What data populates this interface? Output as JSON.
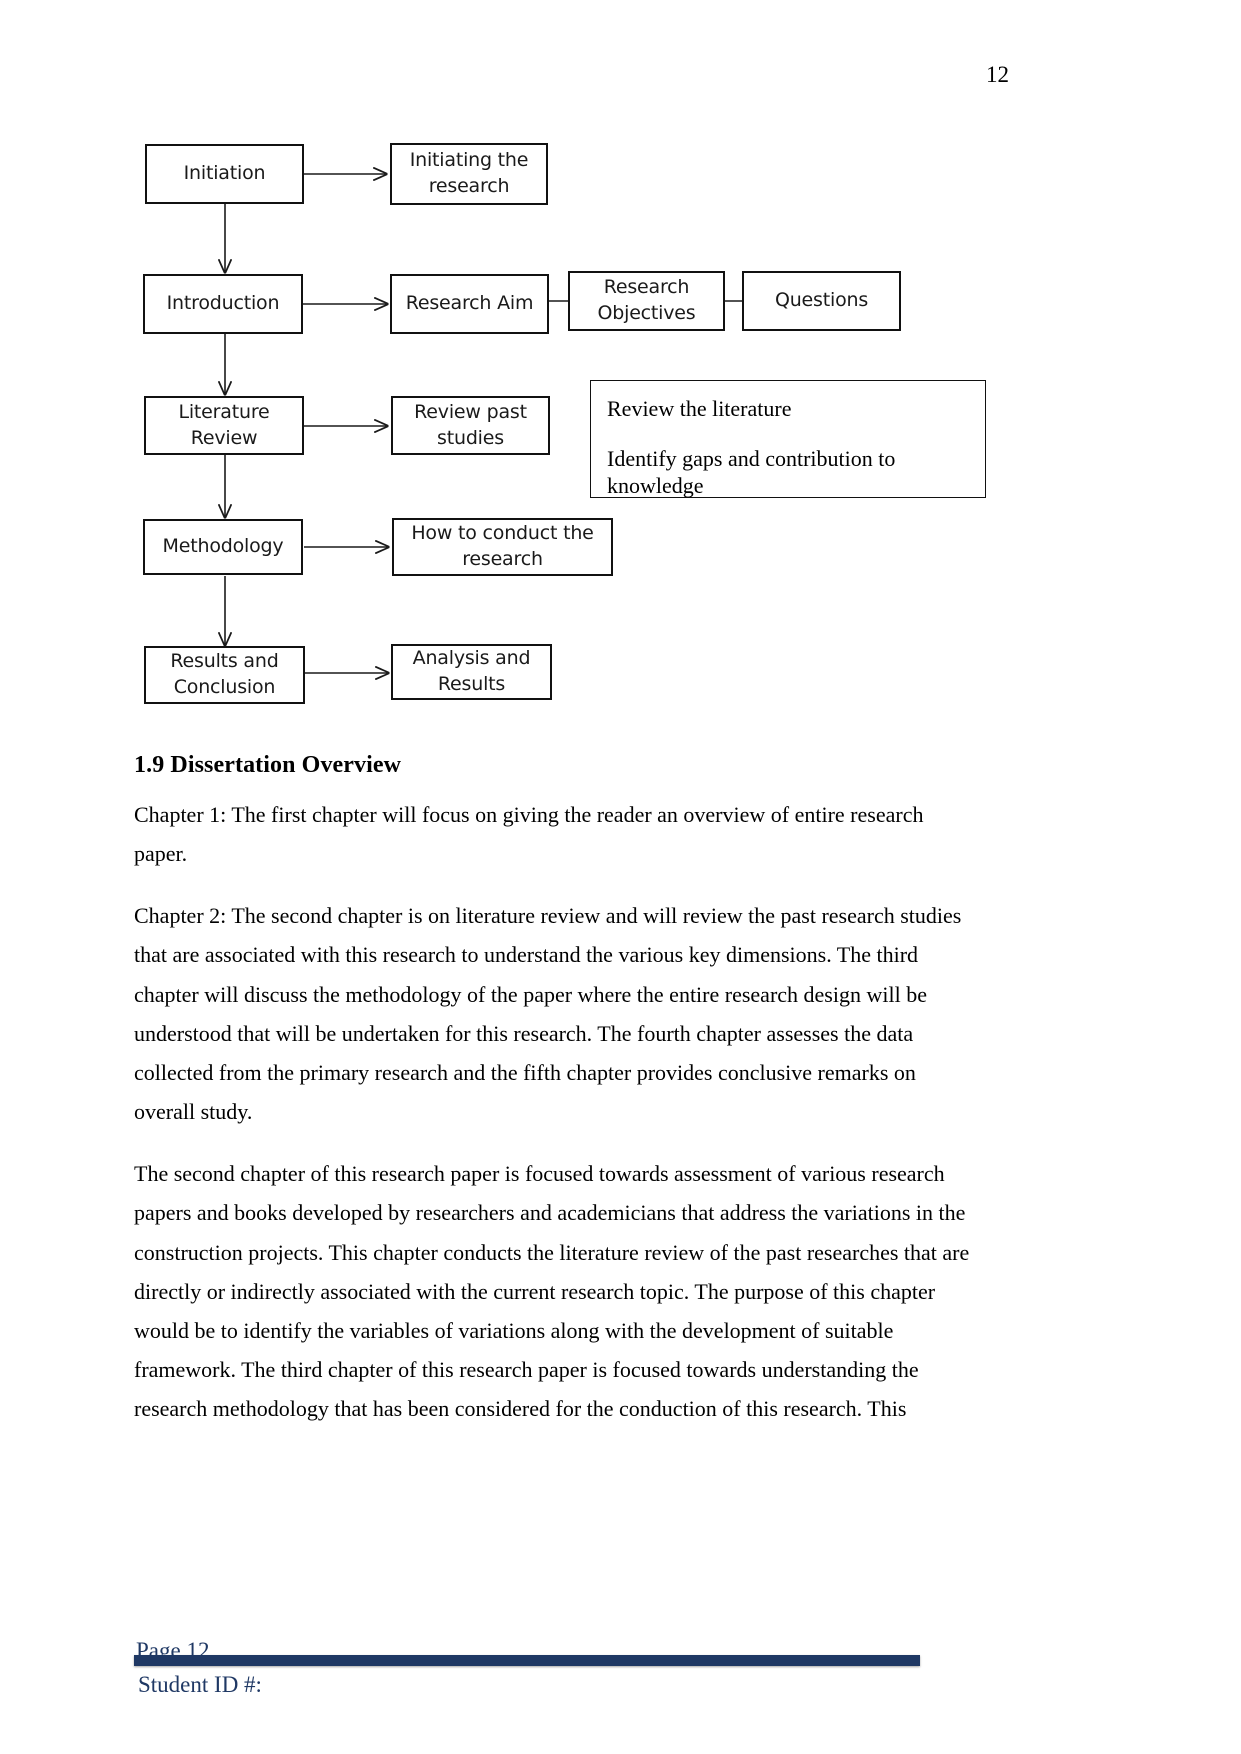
{
  "page": {
    "number": "12"
  },
  "flowchart": {
    "nodes": [
      {
        "id": "initiation",
        "label": "Initiation"
      },
      {
        "id": "initiating-research",
        "label": "Initiating the research"
      },
      {
        "id": "introduction",
        "label": "Introduction"
      },
      {
        "id": "research-aim",
        "label": "Research Aim"
      },
      {
        "id": "research-objectives",
        "label": "Research Objectives"
      },
      {
        "id": "questions",
        "label": "Questions"
      },
      {
        "id": "literature-review",
        "label": "Literature Review"
      },
      {
        "id": "review-past-studies",
        "label": "Review past studies"
      },
      {
        "id": "methodology",
        "label": "Methodology"
      },
      {
        "id": "how-to-conduct",
        "label": "How to conduct the research"
      },
      {
        "id": "results-conclusion",
        "label": "Results and Conclusion"
      },
      {
        "id": "analysis-results",
        "label": "Analysis and Results"
      }
    ],
    "note_box": {
      "line1": "Review the literature",
      "line2": "Identify gaps and contribution to knowledge"
    }
  },
  "section": {
    "heading": "1.9 Dissertation Overview",
    "paragraphs": [
      "Chapter 1: The first chapter will focus on giving the reader an overview of entire research paper.",
      "Chapter 2: The second chapter is on literature review and will review the past research studies that are associated with this research to understand the various key dimensions. The third chapter will discuss the methodology of the paper where the entire research design will be understood that will be undertaken for this research. The fourth chapter assesses the data collected from the primary research and the fifth chapter provides conclusive remarks on overall study.",
      "The second chapter of this research paper is focused towards assessment of various research papers and books developed by researchers and academicians that address the variations in the construction projects. This chapter conducts the literature review of the past researches that are directly or indirectly associated with the current research topic. The purpose of this chapter would be to identify the variables of variations along with the development of suitable framework. The third chapter of this research paper is focused towards understanding the research methodology that has been considered for the conduction of this research. This"
    ]
  },
  "footer": {
    "page_label": "Page 12",
    "student_id": "Student ID #:",
    "rule_color": "#1f3864"
  }
}
